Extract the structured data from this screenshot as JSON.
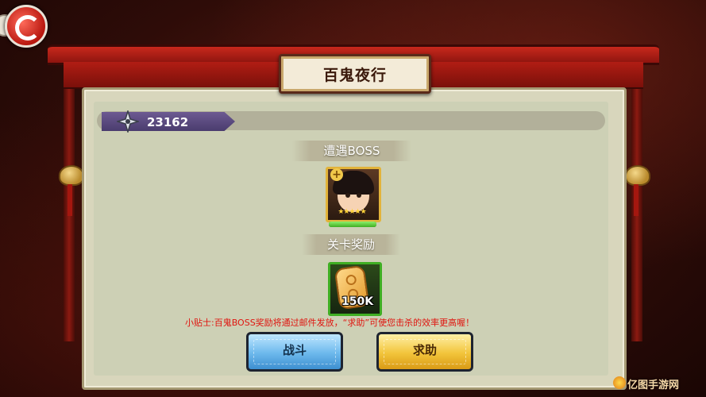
{
  "page": {
    "title": "百鬼夜行"
  },
  "score": {
    "value": "23162",
    "icon": "shuriken-icon"
  },
  "sections": {
    "encounter": "遭遇BOSS",
    "reward": "关卡奖励"
  },
  "boss": {
    "stars": "★★★★★",
    "hp_fraction": 1.0
  },
  "reward": {
    "quantity": "150K",
    "icon": "coin-token-icon"
  },
  "tip": "小贴士:百鬼BOSS奖励将通过邮件发放，“求助”可使您击杀的效率更高喔！",
  "buttons": {
    "fight": "战斗",
    "help": "求助"
  },
  "watermark": "亿图手游网"
}
